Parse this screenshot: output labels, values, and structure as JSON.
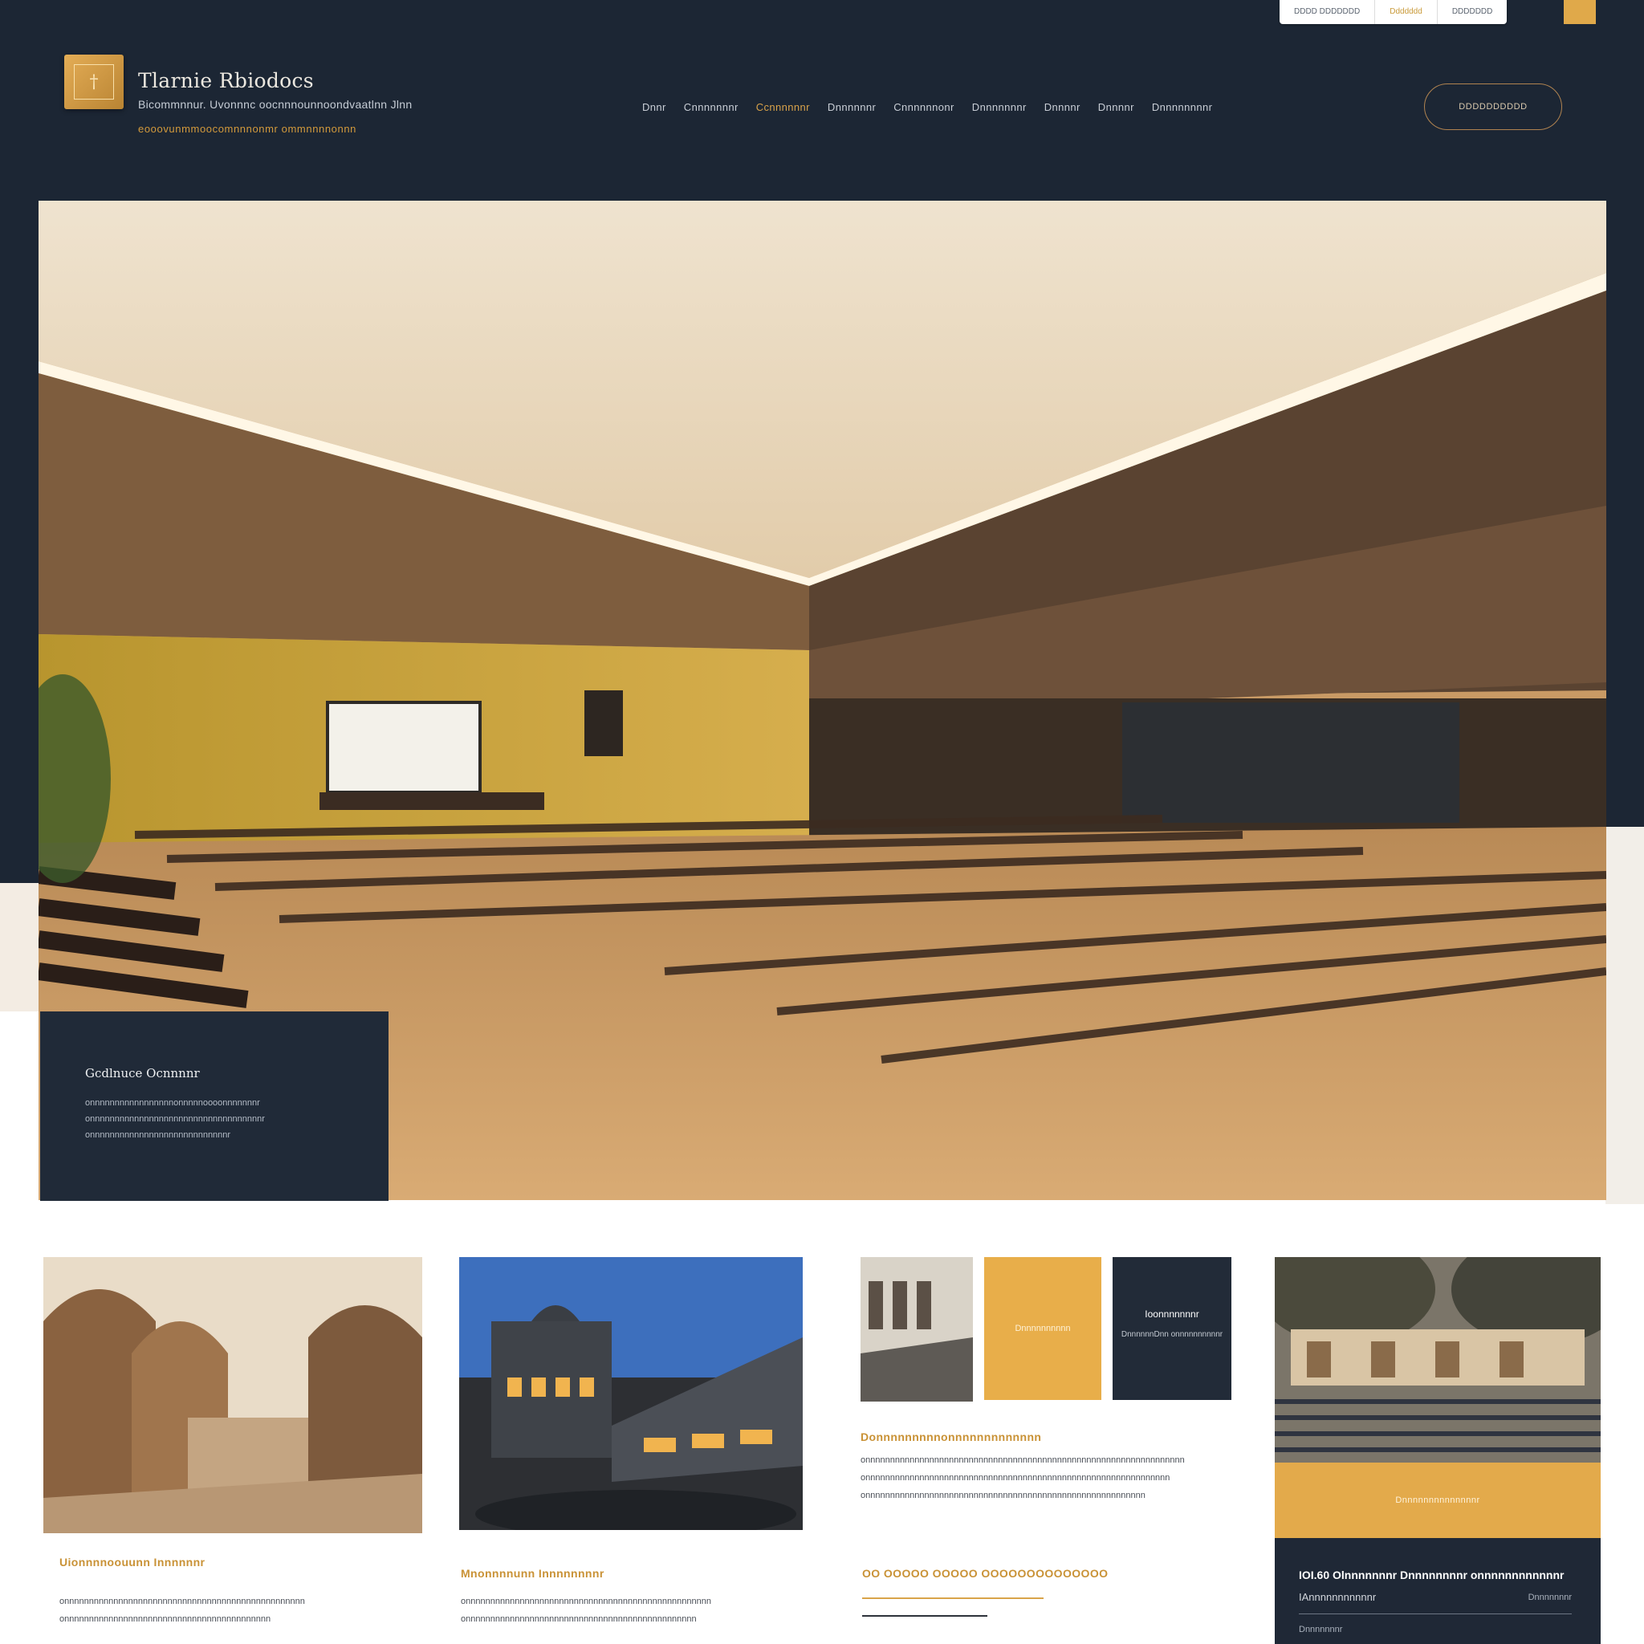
{
  "utility_bar": {
    "tabs": [
      "DDDD DDDDDDD",
      "Ddddddd",
      "DDDDDDD"
    ]
  },
  "brand": {
    "logo_glyph": "†",
    "name": "Tlarnie Rbiodocs",
    "subtitle": "Bicommnnur. Uvonnnc oocnnnounnoondvaatlnn Jlnn",
    "tagline": "eooovunmmoocomnnnonmr ommnnnnonnn"
  },
  "nav": {
    "items": [
      "Dnnr",
      "Cnnnnnnnr",
      "Ccnnnnnnr",
      "Dnnnnnnr",
      "Cnnnnnnonr",
      "Dnnnnnnnr",
      "Dnnnnr",
      "Dnnnnr",
      "Dnnnnnnnnr"
    ],
    "active_index": 2,
    "cta_label": "DDDDDDDDDD"
  },
  "hero": {
    "caption_title": "Gcdlnuce Ocnnnnr",
    "caption_body": "onnnnnnnnnnnnnnnnnonnnnnoooonnnnnnnr onnnnnnnnnnnnnnnnnnnnnnnnnnnnnnnnnnnr onnnnnnnnnnnnnnnnnnnnnnnnnnnnr"
  },
  "cards": [
    {
      "title": "Uionnnnoouunn Innnnnnr",
      "text": "onnnnnnnnnnnnnnnnnnnnnnnnnnnnnnnnnnnnnnnnnnnnnnnnn onnnnnnnnnnnnnnnnnnnnnnnnnnnnnnnnnnnnnnnnnn"
    },
    {
      "title": "Mnonnnnunn Innnnnnnnr",
      "text": "onnnnnnnnnnnnnnnnnnnnnnnnnnnnnnnnnnnnnnnnnnnnnnnnnn onnnnnnnnnnnnnnnnnnnnnnnnnnnnnnnnnnnnnnnnnnnnnnn"
    },
    {
      "tile_gold_text": "Dnnnnnnnnnn",
      "tile_navy_title": "Ioonnnnnnnr",
      "tile_navy_body": "DnnnnnnDnn onnnnnnnnnnr",
      "title": "Donnnnnnnnnonnnnnnnnnnnnn",
      "text": "onnnnnnnnnnnnnnnnnnnnnnnnnnnnnnnnnnnnnnnnnnnnnnnnnnnnnnnnnnnnnnnnn onnnnnnnnnnnnnnnnnnnnnnnnnnnnnnnnnnnnnnnnnnnnnnnnnnnnnnnnnnnnnn onnnnnnnnnnnnnnnnnnnnnnnnnnnnnnnnnnnnnnnnnnnnnnnnnnnnnnnnn",
      "heading2": "OO OOOOO OOOOO OOOOOOOOOOOOOO"
    },
    {
      "band_text": "Dnnnnnnnnnnnnnnr",
      "panel_title": "IOI.60 Olnnnnnnnr Dnnnnnnnnr onnnnnnnnnnnnr",
      "panel_sub": "IAnnnnnnnnnnnr",
      "panel_meta": "Dnnnnnnnr",
      "panel_foot": "Dnnnnnnnr"
    }
  ]
}
